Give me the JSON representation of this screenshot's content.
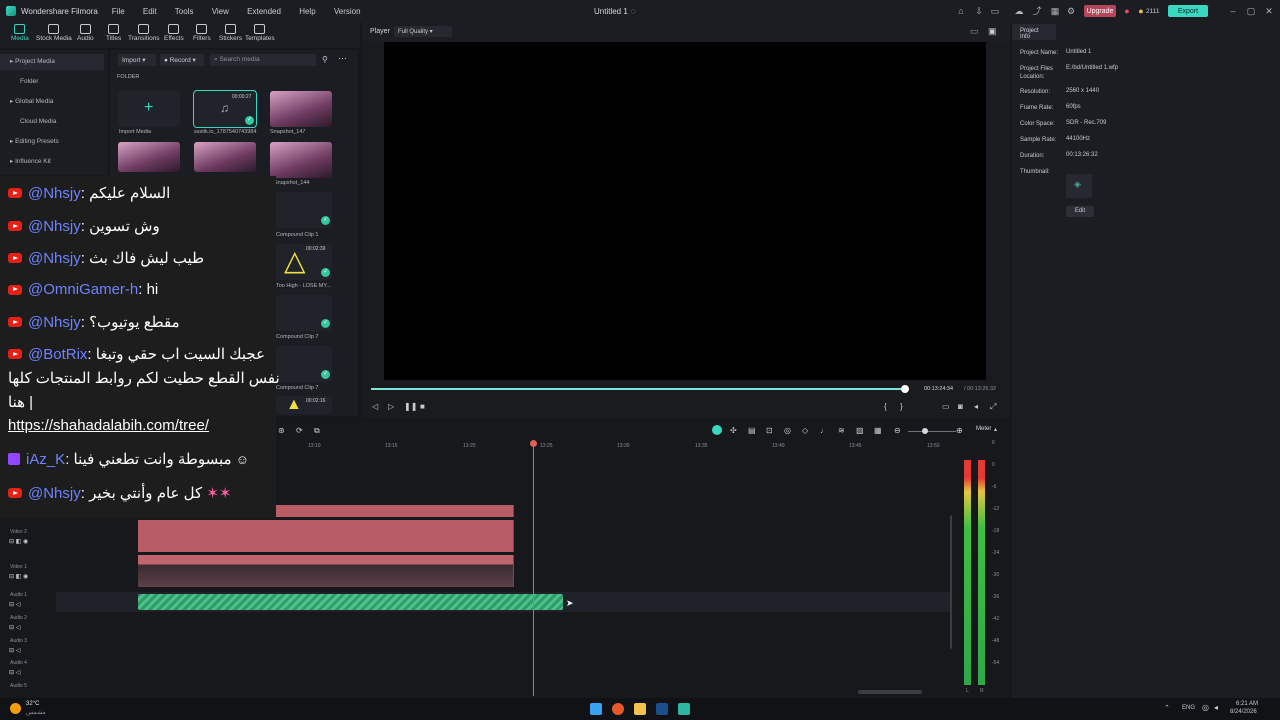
{
  "app": {
    "name": "Wondershare Filmora",
    "menu": [
      "File",
      "Edit",
      "Tools",
      "View",
      "Extended",
      "Help",
      "Version"
    ],
    "project_title": "Untitled 1",
    "upgrade_label": "Upgrade",
    "credits": "2111",
    "export_label": "Export"
  },
  "toolbar": {
    "tools": [
      {
        "label": "Media",
        "icon": "media-icon",
        "active": true
      },
      {
        "label": "Stock Media",
        "icon": "stock-media-icon",
        "active": false
      },
      {
        "label": "Audio",
        "icon": "audio-icon",
        "active": false
      },
      {
        "label": "Titles",
        "icon": "titles-icon",
        "active": false
      },
      {
        "label": "Transitions",
        "icon": "transitions-icon",
        "active": false
      },
      {
        "label": "Effects",
        "icon": "effects-icon",
        "active": false
      },
      {
        "label": "Filters",
        "icon": "filters-icon",
        "active": false
      },
      {
        "label": "Stickers",
        "icon": "stickers-icon",
        "active": false
      },
      {
        "label": "Templates",
        "icon": "templates-icon",
        "active": false
      }
    ]
  },
  "leftnav": {
    "items": [
      "Project Media",
      "Folder",
      "Global Media",
      "Cloud Media",
      "Editing Presets",
      "Influence Kit"
    ]
  },
  "media": {
    "import_label": "Import",
    "record_label": "Record",
    "search_placeholder": "Search media",
    "folder_label": "FOLDER",
    "items": [
      {
        "label": "Import Media",
        "duration": ""
      },
      {
        "label": "ssstik.io_1787540743984",
        "duration": "00:00:27"
      },
      {
        "label": "Snapshot_147",
        "duration": ""
      },
      {
        "label": "Snapshot_144",
        "duration": ""
      },
      {
        "label": "Compound Clip 1",
        "duration": ""
      },
      {
        "label": "Too High - LOSE MY...",
        "duration": "00:02:39"
      },
      {
        "label": "Compound Clip 7",
        "duration": ""
      },
      {
        "label": "Compound Clip 7",
        "duration": ""
      },
      {
        "label": "",
        "duration": "00:02:16"
      }
    ]
  },
  "chat": [
    {
      "platform": "youtube",
      "user": "@Nhsjy",
      "message": "السلام عليكم"
    },
    {
      "platform": "youtube",
      "user": "@Nhsjy",
      "message": "وش تسوين"
    },
    {
      "platform": "youtube",
      "user": "@Nhsjy",
      "message": "طيب ليش فاك بث"
    },
    {
      "platform": "youtube",
      "user": "@OmniGamer-h",
      "message": "hi"
    },
    {
      "platform": "youtube",
      "user": "@Nhsjy",
      "message": "مقطع يوتيوب؟"
    },
    {
      "platform": "youtube",
      "user": "@BotRix",
      "message": "عجبك السيت اب حقي وتبغا",
      "message2": "نفس القطع حطيت لكم روابط المنتجات كلها",
      "message3": "هنا |",
      "link": "https://shahadalabih.com/tree/"
    },
    {
      "platform": "twitch",
      "user": "iAz_K",
      "message": "مبسوطة وانت تطعني فينا"
    },
    {
      "platform": "youtube",
      "user": "@Nhsjy",
      "message": "كل عام وأنتي بخير"
    }
  ],
  "player": {
    "label": "Player",
    "quality": "Full Quality",
    "current_time": "00:13:24:34",
    "total_time": "/ 00:13:26:32",
    "progress": 1.0
  },
  "project_info": {
    "tab": "Project Info",
    "fields": [
      {
        "key": "Project Name:",
        "value": "Untitled 1"
      },
      {
        "key": "Project Files Location:",
        "value": "E:/bd/Untitled 1.wfp"
      },
      {
        "key": "Resolution:",
        "value": "2560 x 1440"
      },
      {
        "key": "Frame Rate:",
        "value": "60fps"
      },
      {
        "key": "Color Space:",
        "value": "SDR - Rec.709"
      },
      {
        "key": "Sample Rate:",
        "value": "44100Hz"
      },
      {
        "key": "Duration:",
        "value": "00:13:26:32"
      },
      {
        "key": "Thumbnail:",
        "value": ""
      }
    ],
    "edit_label": "Edit"
  },
  "timeline": {
    "ruler": [
      "13:10",
      "13:15",
      "13:20",
      "13:25",
      "13:30",
      "13:35",
      "13:40",
      "13:45",
      "13:50"
    ],
    "tracks": [
      "Video 2",
      "Video 1",
      "Audio 1",
      "Audio 2",
      "Audio 3",
      "Audio 4",
      "Audio 5"
    ],
    "meter_label": "Meter",
    "meter_scale": [
      "6",
      "0",
      "-6",
      "-12",
      "-18",
      "-24",
      "-30",
      "-36",
      "-42",
      "-48",
      "-54"
    ],
    "meter_channels": [
      "L",
      "R"
    ]
  },
  "taskbar": {
    "weather_temp": "32°C",
    "weather_desc": "مشمس",
    "lang": "ENG",
    "time": "6:21 AM",
    "date": "8/24/2026"
  }
}
